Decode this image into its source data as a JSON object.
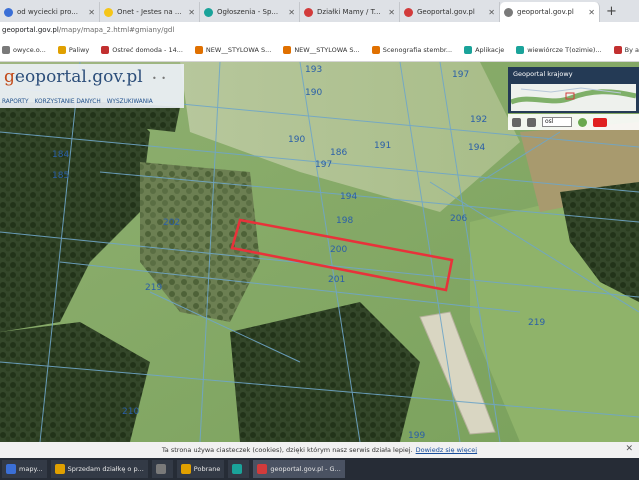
{
  "browser": {
    "tabs": [
      {
        "title": "od wyciecki pro...",
        "favicon_color": "#3b6fd6",
        "active": false
      },
      {
        "title": "Onet - Jestes na ...",
        "favicon_color": "#f5c518",
        "active": false
      },
      {
        "title": "Ogłoszenia - Sp...",
        "favicon_color": "#1aa39a",
        "active": false
      },
      {
        "title": "Działki Mamy / Tor...",
        "favicon_color": "#d23b3b",
        "active": false
      },
      {
        "title": "Geoportal.gov.pl",
        "favicon_color": "#d23b3b",
        "active": false
      },
      {
        "title": "geoportal.gov.pl",
        "favicon_color": "#7a7a7a",
        "active": true
      }
    ],
    "new_tab_label": "+",
    "url": {
      "domain": "geoportal.gov.pl",
      "path": "/mapy/mapa_2.html#gmiany/gdl"
    },
    "bookmarks": [
      {
        "label": "owyce.o...",
        "color": "#7a7a7a"
      },
      {
        "label": "Paliwy",
        "color": "#e0a000"
      },
      {
        "label": "Ostreć domoda - 14...",
        "color": "#c23030"
      },
      {
        "label": "NEW__STYLOWA S...",
        "color": "#e07000"
      },
      {
        "label": "NEW__STYLOWA S...",
        "color": "#e07000"
      },
      {
        "label": "Scenografia stembr...",
        "color": "#e07000"
      },
      {
        "label": "Aplikacje",
        "color": "#1aa39a"
      },
      {
        "label": "wiewiórcze T(ozimie)...",
        "color": "#1aa39a"
      },
      {
        "label": "By a...",
        "color": "#c23030"
      }
    ]
  },
  "geoportal": {
    "logo": {
      "g": "g",
      "rest": "eoportal.gov.pl"
    },
    "logo_dots": "•  •",
    "menu": [
      "RAPORTY",
      "KORZYSTANIE DANYCH",
      "WYSZUKIWANIA"
    ],
    "overview_title": "Geoportal krajowy",
    "scale_select_value": "osl"
  },
  "map": {
    "parcel_labels": [
      "193",
      "190",
      "197",
      "192",
      "191",
      "190",
      "186",
      "184",
      "185",
      "197",
      "194",
      "194",
      "198",
      "201",
      "200",
      "206",
      "202",
      "219",
      "219",
      "210",
      "190",
      "199"
    ],
    "highlight_color": "#e8323a",
    "selected_parcel": "200"
  },
  "cookie": {
    "text": "Ta strona używa ciasteczek (cookies), dzięki którym nasz serwis działa lepiej.",
    "link": "Dowiedz się więcej",
    "close": "✕"
  },
  "taskbar": {
    "items": [
      {
        "label": "mapy...",
        "color": "#3b6fd6",
        "active": false
      },
      {
        "label": "Sprzedam działkę o p...",
        "color": "#e0a000",
        "active": false
      },
      {
        "label": "",
        "color": "#7a7a7a",
        "active": false
      },
      {
        "label": "Pobrane",
        "color": "#e0a000",
        "active": false
      },
      {
        "label": "",
        "color": "#1aa39a",
        "active": false
      },
      {
        "label": "geoportal.gov.pl - G...",
        "color": "#d23b3b",
        "active": true
      }
    ]
  }
}
